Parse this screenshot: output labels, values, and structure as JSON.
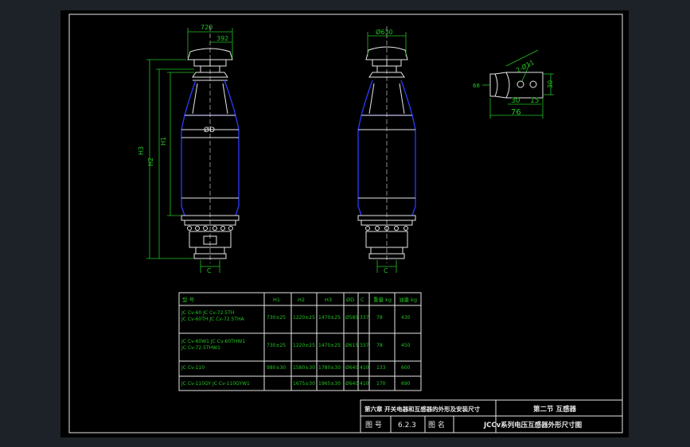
{
  "drawing": {
    "front_dims": {
      "width_overall": "720",
      "width_cap": "392",
      "h1": "H1",
      "h2": "H2",
      "h3": "H3",
      "diameter": "ØD",
      "base": "C"
    },
    "side_dims": {
      "cap_dia": "Ø630",
      "base": "C"
    },
    "detail_dims": {
      "dia": "2-Ø11",
      "d68": "68",
      "d30v": "30",
      "d30": "30",
      "d15": "15",
      "d76": "76"
    }
  },
  "table": {
    "headers": [
      "型    号",
      "H1",
      "H2",
      "H3",
      "ØD",
      "C",
      "重量 kg",
      "油量 kg"
    ],
    "rows": [
      {
        "model": [
          "JC Cv-60   JC Cv-72.5TH",
          "JC Cv-60TH   JC Cv-72.5THA"
        ],
        "h1": "730±25",
        "h2": "1220±25",
        "h3": "1470±25",
        "d": "Ø585",
        "c": "337",
        "w": "78",
        "oil": "430"
      },
      {
        "model": [
          "JC Cv-60W1   JC Cv-60THW1",
          "JC Cv-72.5THW1"
        ],
        "h1": "730±25",
        "h2": "1220±25",
        "h3": "1470±25",
        "d": "Ø615",
        "c": "337",
        "w": "78",
        "oil": "450"
      },
      {
        "model": [
          "JC Cv-110"
        ],
        "h1": "980±30",
        "h2": "1580±30",
        "h3": "1780±30",
        "d": "Ø640",
        "c": "410",
        "w": "133",
        "oil": "600"
      },
      {
        "model": [
          "JC Cv-110GY   JC Cv-110GYW1"
        ],
        "h1": "",
        "h2": "1675±30",
        "h3": "1965±30",
        "d": "Ø640",
        "c": "410",
        "w": "170",
        "oil": "690"
      }
    ]
  },
  "titleblock": {
    "chapter": "第六章  开关电器和互感器的外形及安装尺寸",
    "section": "第二节  互感器",
    "fig_no_label": "图   号",
    "fig_no": "6.2.3",
    "fig_name_label": "图   名",
    "fig_name": "JCCv系列电压互感器外形尺寸图"
  }
}
